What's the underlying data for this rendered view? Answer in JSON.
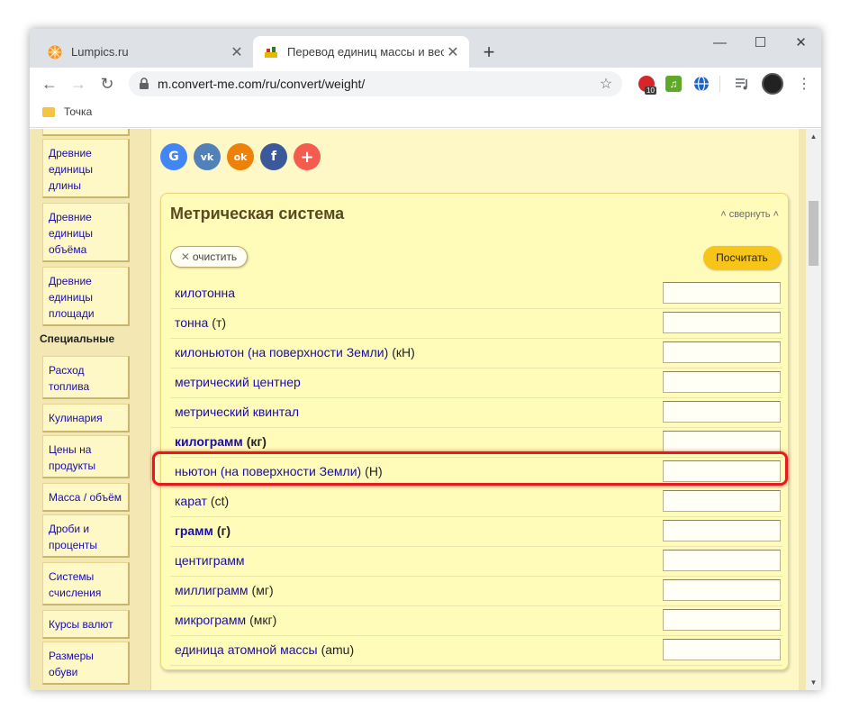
{
  "browser": {
    "tabs": [
      {
        "title": "Lumpics.ru",
        "close": "✕"
      },
      {
        "title": "Перевод единиц массы и веса",
        "close": "✕"
      }
    ],
    "new_tab": "+",
    "window_controls": {
      "minimize": "—",
      "maximize": "☐",
      "close": "✕"
    },
    "nav": {
      "back": "←",
      "forward": "→",
      "reload": "↻",
      "menu": "⋮"
    },
    "address": "m.convert-me.com/ru/convert/weight/",
    "star": "☆",
    "extensions": [
      "opera-badge-10",
      "music-extension",
      "vpn-globe",
      "media-queue"
    ],
    "ext_badge": "10",
    "bookmark_folder": "Точка"
  },
  "sidebar": {
    "items_top": [
      "Древние единицы длины",
      "Древние единицы объёма",
      "Древние единицы площади"
    ],
    "section_heading": "Специальные",
    "items_special": [
      "Расход топлива",
      "Кулинария",
      "Цены на продукты",
      "Масса / объём",
      "Дроби и проценты",
      "Системы счисления",
      "Курсы валют",
      "Размеры обуви"
    ]
  },
  "share": [
    "G",
    "vk",
    "ok",
    "f",
    "+"
  ],
  "share_colors": {
    "google": "#4285f4",
    "vk": "#5181b8",
    "ok": "#ee8208",
    "facebook": "#3b5998",
    "plus": "#f35c4f"
  },
  "panel": {
    "title": "Метрическая система",
    "collapse": "свернуть",
    "clear_button": "очистить",
    "calc_button": "Посчитать",
    "rows": [
      {
        "name": "килотонна",
        "unit": ""
      },
      {
        "name": "тонна",
        "unit": "(т)"
      },
      {
        "name": "килоньютон (на поверхности Земли)",
        "unit": "(кН)"
      },
      {
        "name": "метрический центнер",
        "unit": ""
      },
      {
        "name": "метрический квинтал",
        "unit": ""
      },
      {
        "name": "килограмм",
        "unit": "(кг)"
      },
      {
        "name": "ньютон (на поверхности Земли)",
        "unit": "(Н)"
      },
      {
        "name": "карат",
        "unit": "(ct)"
      },
      {
        "name": "грамм",
        "unit": "(г)"
      },
      {
        "name": "центиграмм",
        "unit": ""
      },
      {
        "name": "миллиграмм",
        "unit": "(мг)"
      },
      {
        "name": "микрограмм",
        "unit": "(мкг)"
      },
      {
        "name": "единица атомной массы",
        "unit": "(amu)"
      }
    ]
  },
  "colors": {
    "accent": "#f7c41a",
    "highlight": "#e51b1b",
    "link": "#1a0dab",
    "page_bg": "#f3e7b3"
  }
}
